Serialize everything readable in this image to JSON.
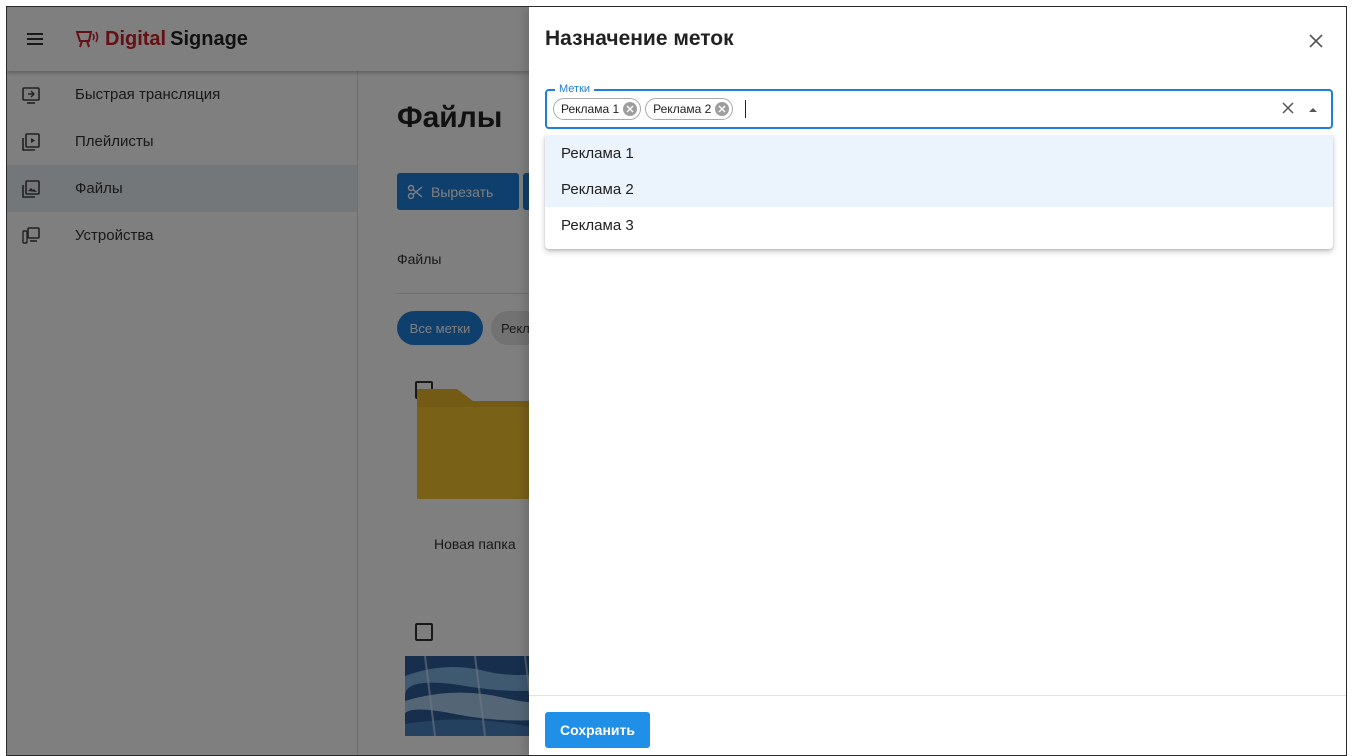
{
  "app": {
    "brand_part1": "Digital",
    "brand_part2": "Signage"
  },
  "sidebar": {
    "items": [
      {
        "label": "Быстрая трансляция",
        "icon": "quick-broadcast-icon"
      },
      {
        "label": "Плейлисты",
        "icon": "playlist-icon"
      },
      {
        "label": "Файлы",
        "icon": "files-icon",
        "active": true
      },
      {
        "label": "Устройства",
        "icon": "devices-icon"
      }
    ]
  },
  "main": {
    "title": "Файлы",
    "cut_label": "Вырезать",
    "breadcrumb": "Файлы",
    "chip_all": "Все метки",
    "chip_other": "Рекл",
    "folder_name": "Новая папка"
  },
  "drawer": {
    "title": "Назначение меток",
    "field_label": "Метки",
    "selected_tags": [
      "Реклама 1",
      "Реклама 2"
    ],
    "options": [
      "Реклама 1",
      "Реклама 2",
      "Реклама 3"
    ],
    "save_label": "Сохранить"
  },
  "colors": {
    "accent": "#1f7fd8",
    "brand_red": "#c8202a",
    "folder_yellow": "#f2c230"
  }
}
